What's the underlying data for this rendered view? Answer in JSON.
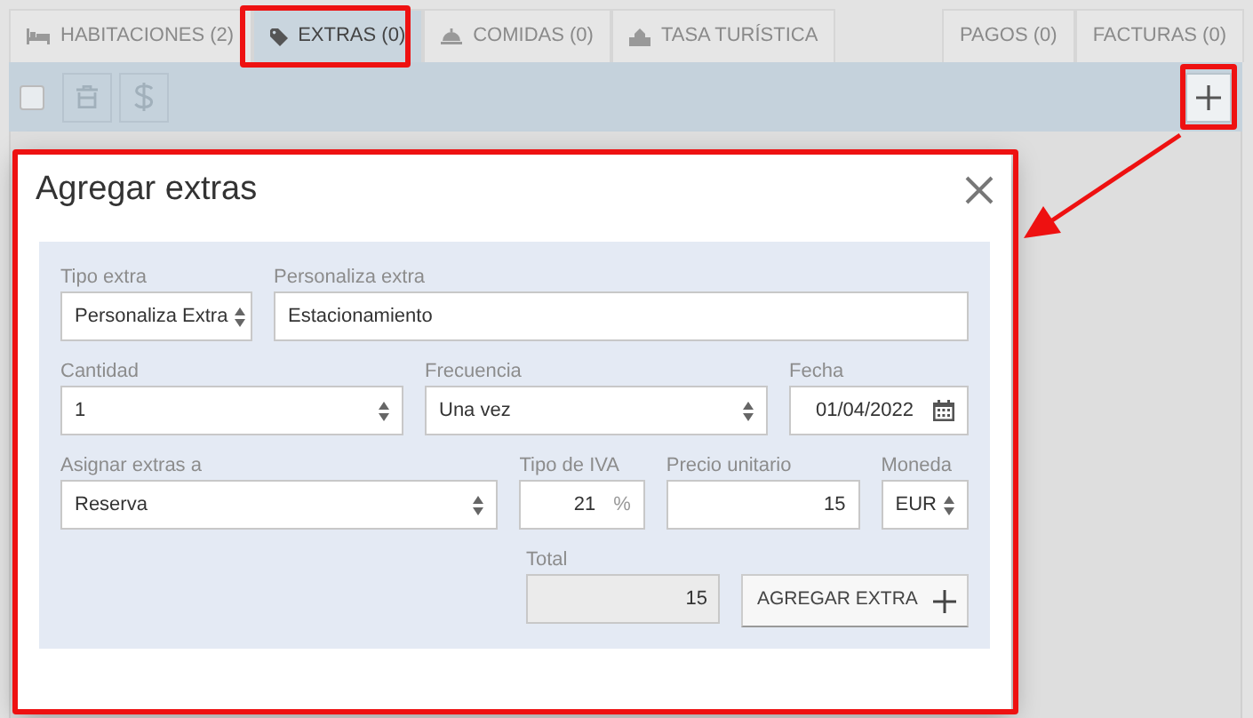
{
  "tabs": [
    {
      "label": "HABITACIONES (2)",
      "selected": false
    },
    {
      "label": "EXTRAS (0)",
      "selected": true
    },
    {
      "label": "COMIDAS (0)",
      "selected": false
    },
    {
      "label": "TASA TURÍSTICA",
      "selected": false
    }
  ],
  "right_tabs": [
    {
      "label": "PAGOS (0)",
      "selected": false
    },
    {
      "label": "FACTURAS (0)",
      "selected": false
    }
  ],
  "toolbar": {
    "select_all": {
      "checked": false
    },
    "buttons": [
      {
        "kind": "trash",
        "disabled": true
      },
      {
        "kind": "dollar",
        "disabled": true
      }
    ]
  },
  "dialog": {
    "title": "Agregar extras",
    "rows": [
      [
        {
          "label": "Tipo extra",
          "kind": "select",
          "value": "Personaliza Extra"
        },
        {
          "label": "Personaliza extra",
          "kind": "text",
          "value": "Estacionamiento"
        }
      ],
      [
        {
          "label": "Cantidad",
          "kind": "number",
          "value": "1"
        },
        {
          "label": "Frecuencia",
          "kind": "select",
          "value": "Una vez"
        },
        {
          "label": "Fecha",
          "kind": "date",
          "value": "01/04/2022"
        }
      ],
      [
        {
          "label": "Asignar extras a",
          "kind": "select",
          "value": "Reserva"
        },
        {
          "label": "Tipo de IVA",
          "kind": "percent",
          "value": "21",
          "suffix": "%"
        },
        {
          "label": "Precio unitario",
          "kind": "amount",
          "value": "15"
        },
        {
          "label": "Moneda",
          "kind": "select",
          "value": "EUR"
        }
      ]
    ],
    "total": {
      "label": "Total",
      "value": "15",
      "disabled": true
    },
    "submit": "AGREGAR EXTRA"
  },
  "annotations": [
    {
      "kind": "box"
    },
    {
      "kind": "box"
    },
    {
      "kind": "box"
    },
    {
      "kind": "arrow"
    }
  ]
}
